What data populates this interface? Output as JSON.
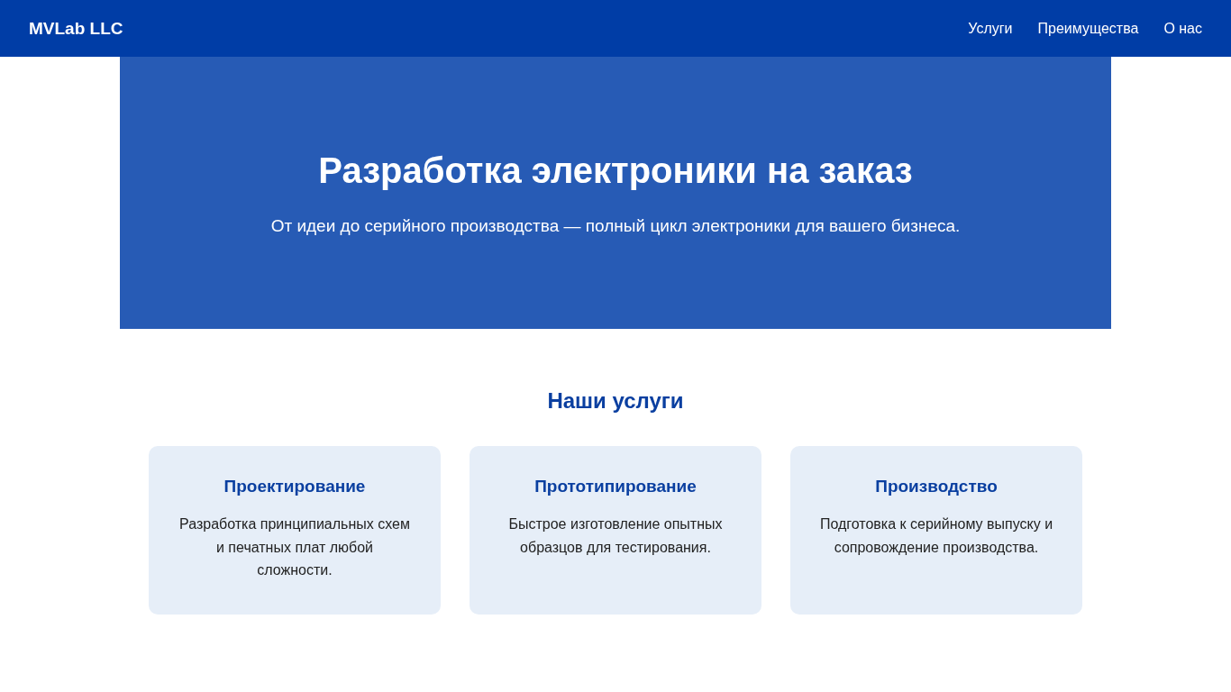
{
  "header": {
    "logo": "MVLab LLC",
    "nav": [
      "Услуги",
      "Преимущества",
      "О нас"
    ]
  },
  "hero": {
    "title": "Разработка электроники на заказ",
    "subtitle": "От идеи до серийного производства — полный цикл электроники для вашего бизнеса."
  },
  "services": {
    "title": "Наши услуги",
    "cards": [
      {
        "title": "Проектирование",
        "text": "Разработка принципиальных схем и печатных плат любой сложности."
      },
      {
        "title": "Прототипирование",
        "text": "Быстрое изготовление опытных образцов для тестирования."
      },
      {
        "title": "Производство",
        "text": "Подготовка к серийному выпуску и сопровождение производства."
      }
    ]
  }
}
